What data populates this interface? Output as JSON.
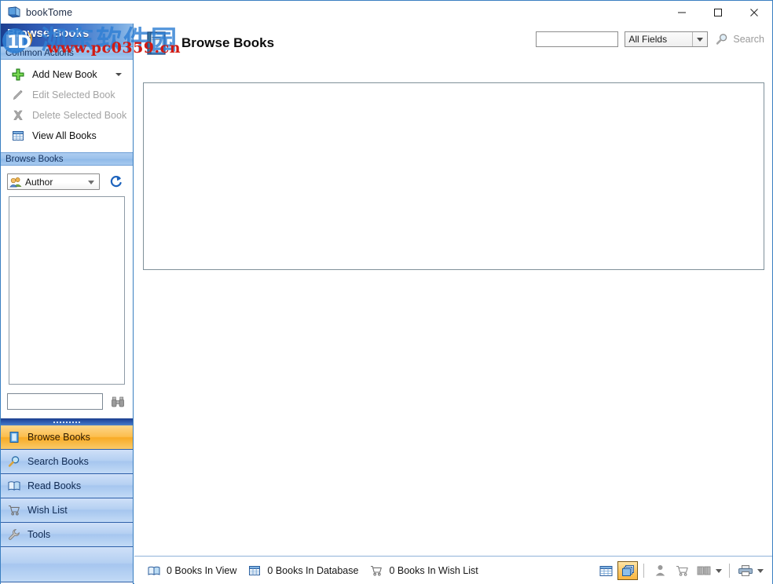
{
  "window": {
    "title": "bookTome",
    "icon": "book-icon",
    "controls": {
      "minimize": "–",
      "maximize": "☐",
      "close": "✕"
    }
  },
  "sidebar": {
    "header_title": "Browse Books",
    "sections": [
      {
        "caption": "Common Actions"
      },
      {
        "caption": "Browse Books"
      }
    ],
    "common_actions": [
      {
        "label": "Add New Book",
        "icon": "plus-green-icon",
        "disabled": false,
        "has_dropdown": true
      },
      {
        "label": "Edit Selected Book",
        "icon": "pencil-icon",
        "disabled": true,
        "has_dropdown": false
      },
      {
        "label": "Delete Selected Book",
        "icon": "delete-x-icon",
        "disabled": true,
        "has_dropdown": false
      },
      {
        "label": "View All Books",
        "icon": "table-grid-icon",
        "disabled": false,
        "has_dropdown": false
      }
    ],
    "browse": {
      "filter_combo": {
        "value": "Author",
        "icon": "users-icon"
      },
      "refresh_icon": "refresh-arrow-icon",
      "list_items": [],
      "quick_find": {
        "value": "",
        "placeholder": ""
      },
      "quick_find_icon": "binoculars-icon"
    },
    "nav_items": [
      {
        "label": "Browse Books",
        "icon": "book-blue-icon",
        "selected": true
      },
      {
        "label": "Search Books",
        "icon": "magnifier-icon",
        "selected": false
      },
      {
        "label": "Read Books",
        "icon": "open-book-icon",
        "selected": false
      },
      {
        "label": "Wish List",
        "icon": "cart-icon",
        "selected": false
      },
      {
        "label": "Tools",
        "icon": "wrench-icon",
        "selected": false
      }
    ]
  },
  "content": {
    "title": "Browse Books",
    "title_icon": "book-large-icon",
    "search": {
      "input_value": "",
      "input_placeholder": "",
      "field_combo_value": "All Fields",
      "field_combo_options": [
        "All Fields"
      ],
      "search_label": "Search",
      "search_icon": "magnifier-icon"
    }
  },
  "status_bar": {
    "items": [
      {
        "label": "0 Books In View",
        "icon": "open-book-icon"
      },
      {
        "label": "0 Books In Database",
        "icon": "table-grid-icon"
      },
      {
        "label": "0 Books In Wish List",
        "icon": "cart-icon"
      }
    ],
    "tools": [
      {
        "name": "grid-view-button",
        "icon": "table-grid-icon",
        "active": false
      },
      {
        "name": "cover-view-button",
        "icon": "stacked-covers-icon",
        "active": true
      },
      {
        "name": "author-button",
        "icon": "person-icon",
        "active": false
      },
      {
        "name": "wishlist-button",
        "icon": "cart-icon",
        "active": false
      },
      {
        "name": "series-button",
        "icon": "books-pair-icon",
        "active": false
      },
      {
        "name": "print-button",
        "icon": "printer-icon",
        "active": false
      }
    ]
  },
  "watermark": {
    "chinese_text": "洳东软件园",
    "url_text": "www.pc0359.cn"
  },
  "colors": {
    "accent_blue": "#2b55ae",
    "selected_orange": "#f8ab25",
    "nav_blue": "#b5d0f2",
    "frame_border": "#3a7fc1"
  }
}
